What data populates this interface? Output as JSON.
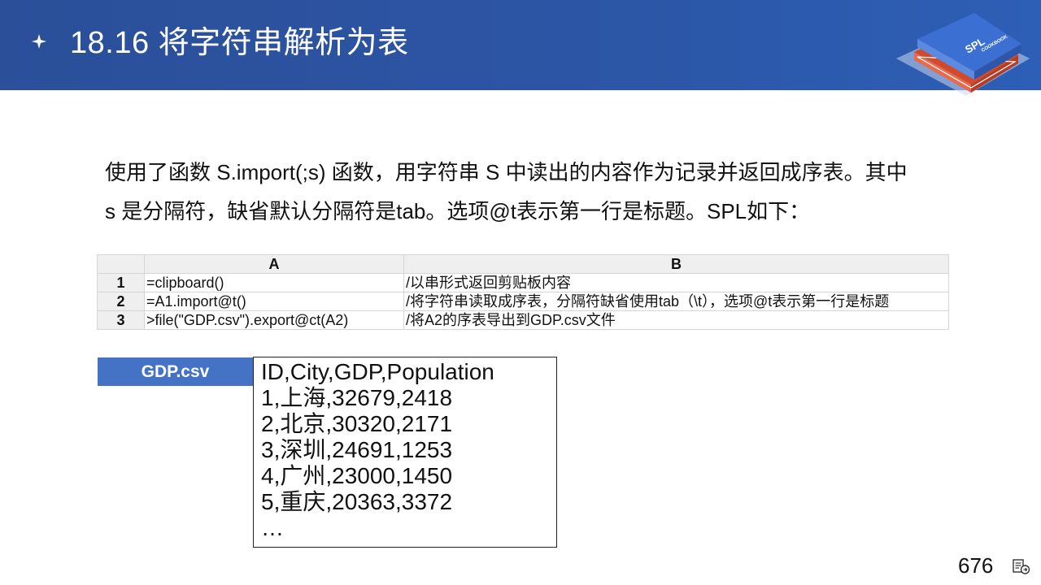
{
  "header": {
    "title": "18.16  将字符串解析为表",
    "logo_text": "SPL",
    "logo_subtext": "COOKBOOK",
    "colors": {
      "banner": "#2c56a6",
      "book_blue": "#3b6fd1",
      "book_red": "#e0583c"
    }
  },
  "description": {
    "line1": "使用了函数 S.import(;s) 函数，用字符串 S 中读出的内容作为记录并返回成序表。其中",
    "line2": "s 是分隔符，缺省默认分隔符是tab。选项@t表示第一行是标题。SPL如下："
  },
  "spl": {
    "columns": [
      "A",
      "B"
    ],
    "rows": [
      {
        "num": "1",
        "a": "=clipboard()",
        "b": "/以串形式返回剪贴板内容"
      },
      {
        "num": "2",
        "a": "=A1.import@t()",
        "b": "/将字符串读取成序表，分隔符缺省使用tab（\\t），选项@t表示第一行是标题"
      },
      {
        "num": "3",
        "a": ">file(\"GDP.csv\").export@ct(A2)",
        "b": "/将A2的序表导出到GDP.csv文件"
      }
    ]
  },
  "file": {
    "label": "GDP.csv",
    "lines": [
      "ID,City,GDP,Population",
      "1,上海,32679,2418",
      "2,北京,30320,2171",
      "3,深圳,24691,1253",
      "4,广州,23000,1450",
      "5,重庆,20363,3372",
      "…"
    ]
  },
  "footer": {
    "page_number": "676"
  }
}
